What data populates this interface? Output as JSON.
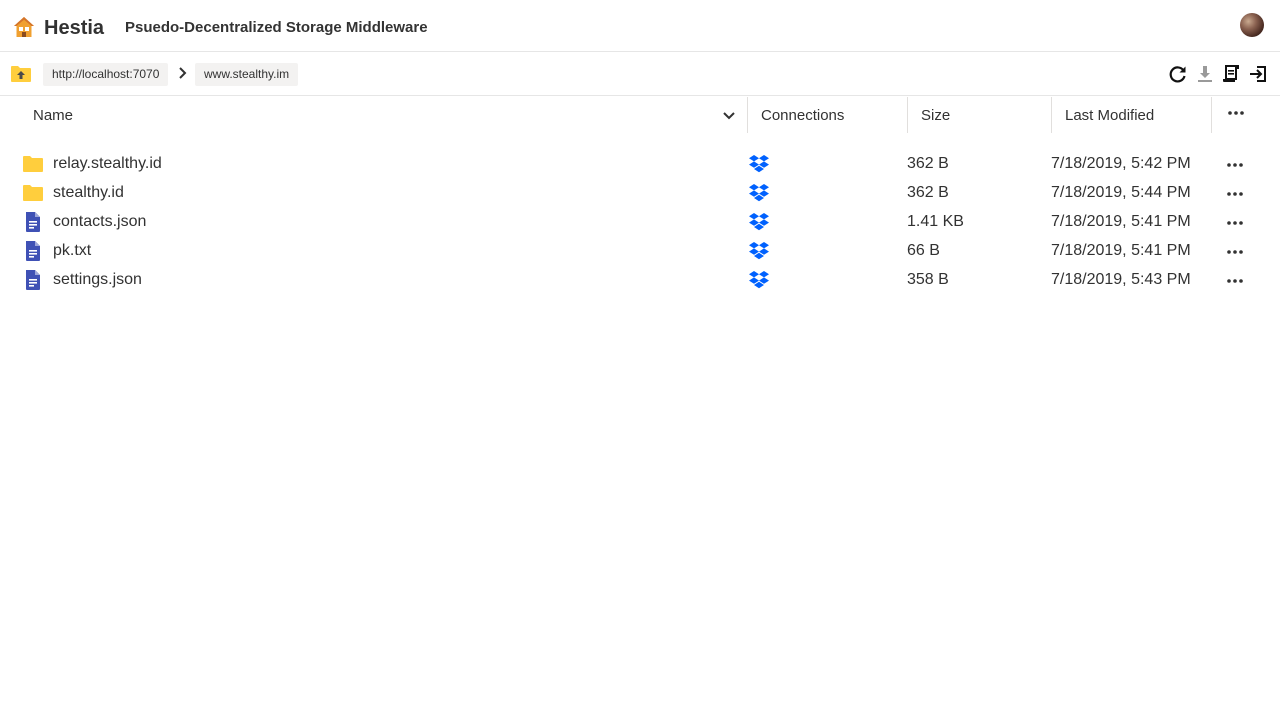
{
  "header": {
    "app_name": "Hestia",
    "subtitle": "Psuedo-Decentralized Storage Middleware",
    "logo_icon": "house-icon",
    "avatar_icon": "avatar"
  },
  "toolbar": {
    "up_icon": "folder-up-icon",
    "breadcrumbs": [
      {
        "label": "http://localhost:7070"
      },
      {
        "label": "www.stealthy.im"
      }
    ],
    "separator_icon": "chevron-right-icon",
    "actions": [
      {
        "icon": "refresh-icon"
      },
      {
        "icon": "download-icon"
      },
      {
        "icon": "scroll-icon"
      },
      {
        "icon": "sign-out-icon"
      }
    ]
  },
  "columns": {
    "name": "Name",
    "connections": "Connections",
    "size": "Size",
    "last_modified": "Last Modified"
  },
  "files": [
    {
      "type": "folder",
      "name": "relay.stealthy.id",
      "connection": "dropbox",
      "size": "362 B",
      "modified": "7/18/2019, 5:42 PM"
    },
    {
      "type": "folder",
      "name": "stealthy.id",
      "connection": "dropbox",
      "size": "362 B",
      "modified": "7/18/2019, 5:44 PM"
    },
    {
      "type": "file",
      "name": "contacts.json",
      "connection": "dropbox",
      "size": "1.41 KB",
      "modified": "7/18/2019, 5:41 PM"
    },
    {
      "type": "file",
      "name": "pk.txt",
      "connection": "dropbox",
      "size": "66 B",
      "modified": "7/18/2019, 5:41 PM"
    },
    {
      "type": "file",
      "name": "settings.json",
      "connection": "dropbox",
      "size": "358 B",
      "modified": "7/18/2019, 5:43 PM"
    }
  ],
  "colors": {
    "folder": "#ffce3d",
    "file": "#3f51b5",
    "dropbox": "#0061fe",
    "accent_logo": "#f0a030"
  }
}
